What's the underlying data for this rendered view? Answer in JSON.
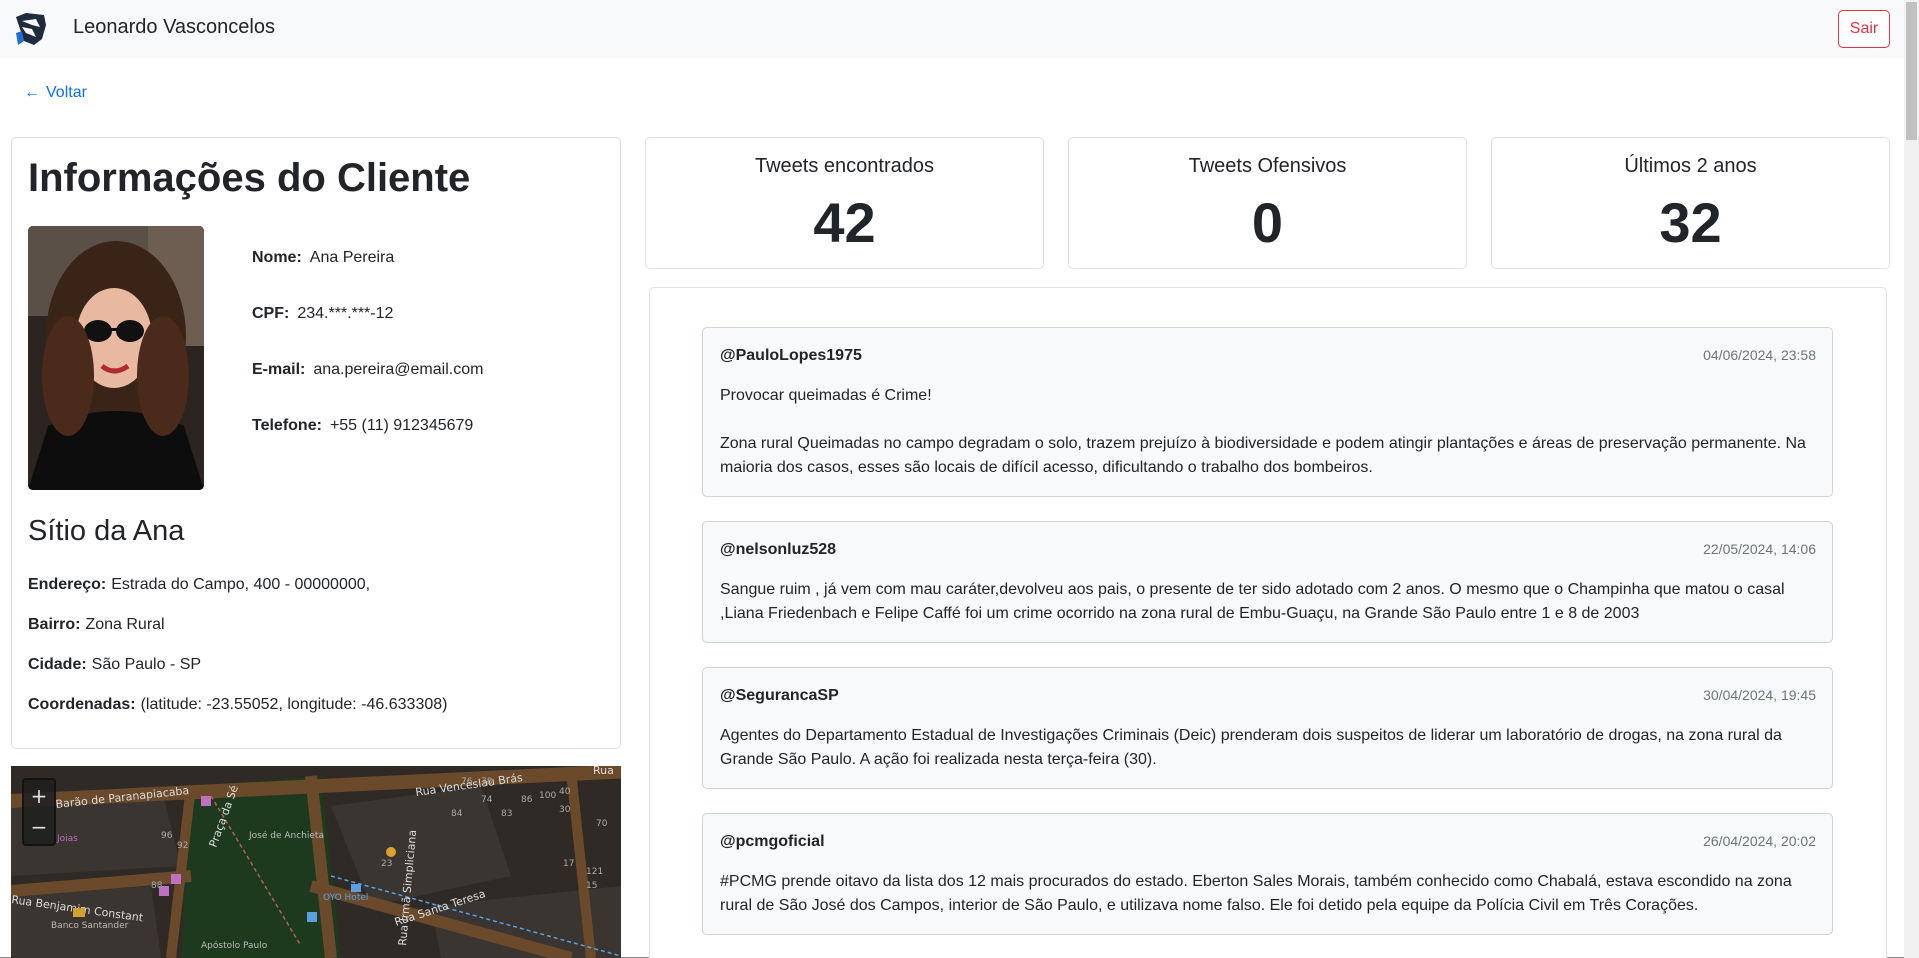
{
  "navbar": {
    "user_name": "Leonardo Vasconcelos",
    "logout_label": "Sair"
  },
  "back": {
    "arrow": "←",
    "label": "Voltar"
  },
  "client": {
    "title": "Informações do Cliente",
    "name_label": "Nome:",
    "name": "Ana Pereira",
    "cpf_label": "CPF:",
    "cpf": "234.***.***-12",
    "email_label": "E-mail:",
    "email": "ana.pereira@email.com",
    "phone_label": "Telefone:",
    "phone": "+55 (11) 912345679"
  },
  "property": {
    "name": "Sítio da Ana",
    "address_label": "Endereço:",
    "address": "Estrada do Campo, 400 - 00000000,",
    "district_label": "Bairro:",
    "district": "Zona Rural",
    "city_label": "Cidade:",
    "city": "São Paulo - SP",
    "coords_label": "Coordenadas:",
    "coords": "(latitude: -23.55052, longitude: -46.633308)"
  },
  "map": {
    "zoom_in": "+",
    "zoom_out": "−",
    "streets": [
      "Barão de Paranapiacaba",
      "Praça da Sé",
      "Rua Venceslau Brás",
      "Rua Irmã Simpliciana",
      "Rua Benjamim Constant",
      "Rua Santa Teresa",
      "Rua"
    ],
    "places": [
      "Joias",
      "José de Anchieta",
      "OYO Hotel",
      "Banco Santander",
      "Apóstolo Paulo"
    ],
    "numbers": [
      "92",
      "96",
      "88",
      "74",
      "86",
      "100",
      "40",
      "30",
      "23",
      "17",
      "121",
      "15",
      "70",
      "76",
      "78",
      "83",
      "84"
    ]
  },
  "stats": [
    {
      "label": "Tweets encontrados",
      "value": "42"
    },
    {
      "label": "Tweets Ofensivos",
      "value": "0"
    },
    {
      "label": "Últimos 2 anos",
      "value": "32"
    }
  ],
  "tweets": [
    {
      "user": "@PauloLopes1975",
      "date": "04/06/2024, 23:58",
      "text": "Provocar queimadas é Crime!\n\nZona rural Queimadas no campo degradam o solo, trazem prejuízo à biodiversidade e podem atingir plantações e áreas de preservação permanente. Na maioria dos casos, esses são locais de difícil acesso, dificultando o trabalho dos bombeiros."
    },
    {
      "user": "@nelsonluz528",
      "date": "22/05/2024, 14:06",
      "text": "Sangue ruim , já vem com mau caráter,devolveu aos pais, o presente de ter sido adotado com 2 anos. O mesmo que o Champinha que matou o casal ,Liana Friedenbach e Felipe Caffé foi um crime ocorrido na zona rural de Embu-Guaçu, na Grande São Paulo entre 1 e 8 de 2003"
    },
    {
      "user": "@SegurancaSP",
      "date": "30/04/2024, 19:45",
      "text": "Agentes do Departamento Estadual de Investigações Criminais (Deic) prenderam dois suspeitos de liderar um laboratório de drogas, na zona rural da Grande São Paulo. A ação foi realizada nesta terça-feira (30)."
    },
    {
      "user": "@pcmgoficial",
      "date": "26/04/2024, 20:02",
      "text": "#PCMG prende oitavo da lista dos 12 mais procurados do estado. Eberton Sales Morais, também conhecido como Chabalá, estava escondido na zona rural de São José dos Campos, interior de São Paulo, e utilizava nome falso. Ele foi detido pela equipe da Polícia Civil em Três Corações."
    }
  ]
}
